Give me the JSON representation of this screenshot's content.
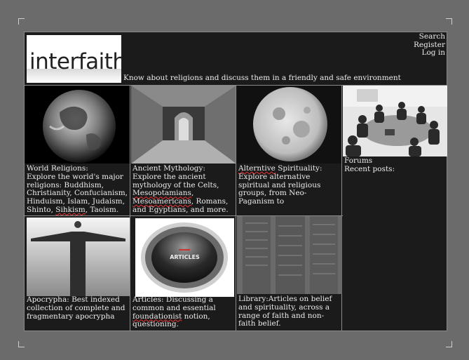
{
  "site": {
    "logo_text": "interfaith",
    "tagline": "Know about religions and discuss them in a friendly and safe environment"
  },
  "nav": {
    "search": "Search",
    "register": "Register",
    "login": "Log in"
  },
  "tiles": [
    {
      "title": "World Religions:",
      "desc_a": "Explore the world's major religions: Buddhism, Christianity, Confucianism, Hinduism, Islam, Judaism, Shinto, ",
      "desc_sq": "Sihkism",
      "desc_b": ", Taoism."
    },
    {
      "title": "Ancient Mythology:",
      "desc_a": "Explore the ancient mythology of the Celts, ",
      "desc_sq1": "Mesopotamians",
      "desc_mid": ", ",
      "desc_sq2": "Mesoamericans",
      "desc_b": ", Romans, and Egyptians, and more."
    },
    {
      "title_sq": "Alterntive",
      "title_b": " Spirituality:",
      "desc": "Explore alternative spiritual and religious groups, from Neo-Paganism to"
    },
    {
      "line1": "Forums",
      "line2": "Recent posts:"
    },
    {
      "text": "Apocrypha: Best indexed collection of complete and fragmentary apocrypha"
    },
    {
      "desc_a": "Articles: Discussing a common and essential ",
      "desc_sq": "foundationist",
      "desc_b": " notion, questioning.",
      "badge": "ARTICLES"
    },
    {
      "text": "Library:Articles on belief and spirituality, across a range of faith and non-faith belief."
    }
  ],
  "colors": {
    "page_bg": "#6b6b6b",
    "panel_bg": "#1b1b1b",
    "text": "#ececec",
    "spellcheck_underline": "#d33"
  }
}
